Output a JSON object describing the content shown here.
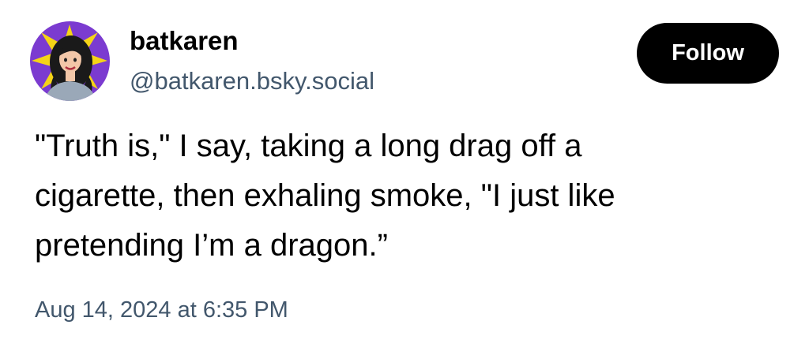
{
  "author": {
    "display_name": "batkaren",
    "handle": "@batkaren.bsky.social"
  },
  "follow_button": {
    "label": "Follow"
  },
  "post": {
    "text": "\"Truth is,\" I say, taking a long drag off a\ncigarette, then exhaling smoke, \"I just like\npretending I’m a dragon.”",
    "timestamp": "Aug 14, 2024 at 6:35 PM"
  },
  "colors": {
    "background": "#ffffff",
    "text_primary": "#000000",
    "text_secondary": "#42576c",
    "button_background": "#000000",
    "button_text": "#ffffff",
    "avatar_background": "#7b3bd0",
    "avatar_burst": "#f5d417"
  }
}
